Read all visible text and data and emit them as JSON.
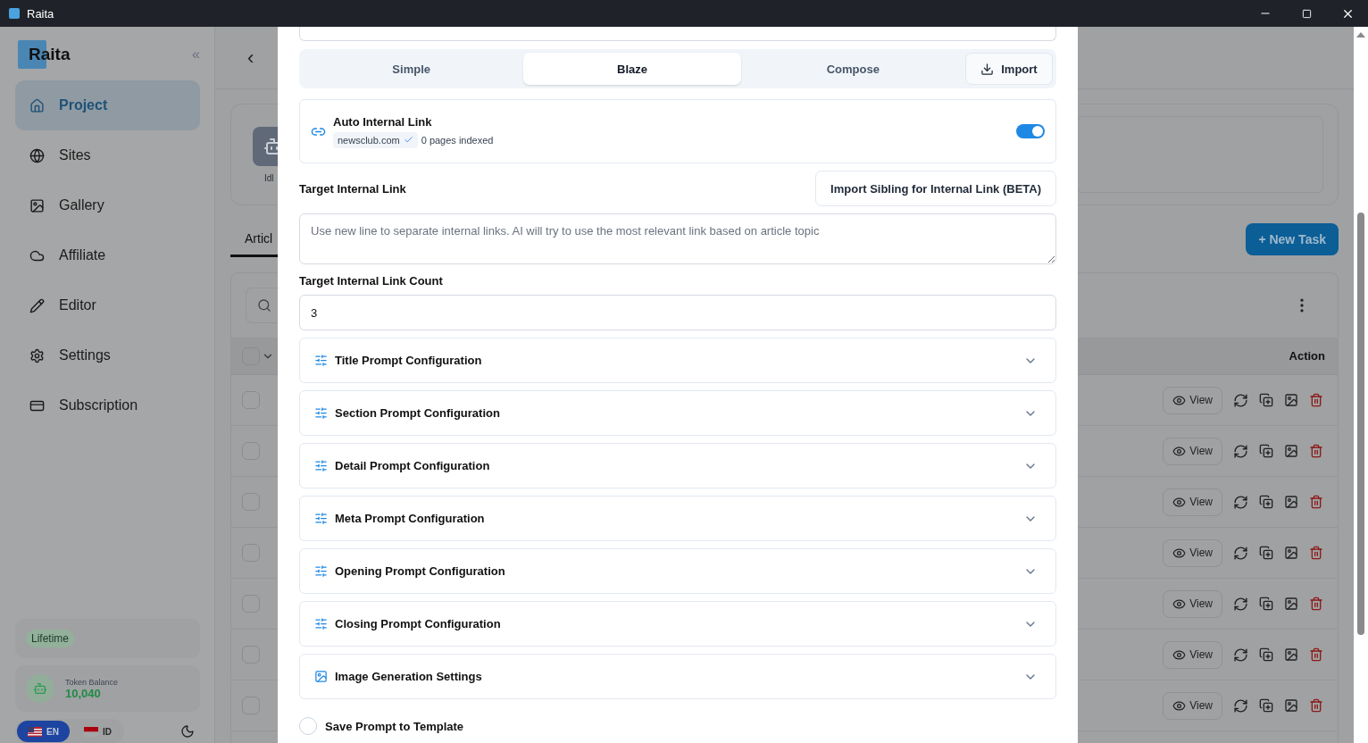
{
  "window": {
    "title": "Raita"
  },
  "sidebar": {
    "logo": "Raita",
    "collapse": "«",
    "items": [
      {
        "label": "Project",
        "selected": true
      },
      {
        "label": "Sites",
        "selected": false
      },
      {
        "label": "Gallery",
        "selected": false
      },
      {
        "label": "Affiliate",
        "selected": false
      },
      {
        "label": "Editor",
        "selected": false
      },
      {
        "label": "Settings",
        "selected": false
      },
      {
        "label": "Subscription",
        "selected": false
      }
    ],
    "plan": "Lifetime",
    "token_label": "Token Balance",
    "token_value": "10,040",
    "languages": [
      {
        "code": "EN",
        "selected": true
      },
      {
        "code": "ID",
        "selected": false
      }
    ]
  },
  "main": {
    "back": "‹",
    "status": "Idl",
    "tab": "Articl",
    "new_task": "+ New Task",
    "action_header": "Action",
    "select_all_checked": false,
    "rows": [
      {
        "view": "View",
        "checked": false
      },
      {
        "view": "View",
        "checked": false
      },
      {
        "view": "View",
        "checked": false
      },
      {
        "view": "View",
        "checked": false
      },
      {
        "view": "View",
        "checked": false
      },
      {
        "view": "View",
        "checked": false
      },
      {
        "view": "View",
        "checked": false
      }
    ]
  },
  "modal": {
    "modes": [
      {
        "label": "Simple",
        "selected": false
      },
      {
        "label": "Blaze",
        "selected": true
      },
      {
        "label": "Compose",
        "selected": false
      }
    ],
    "import": "Import",
    "auto_link": {
      "title": "Auto Internal Link",
      "domain": "newsclub.com",
      "indexed": "0 pages indexed",
      "on": true
    },
    "target_label": "Target Internal Link",
    "import_sibling": "Import Sibling for Internal Link (BETA)",
    "target_placeholder": "Use new line to separate internal links. AI will try to use the most relevant link based on article topic",
    "count_label": "Target Internal Link Count",
    "count_value": "3",
    "sections": [
      {
        "title": "Title Prompt Configuration",
        "kind": "prompt",
        "expanded": false
      },
      {
        "title": "Section Prompt Configuration",
        "kind": "prompt",
        "expanded": false
      },
      {
        "title": "Detail Prompt Configuration",
        "kind": "prompt",
        "expanded": false
      },
      {
        "title": "Meta Prompt Configuration",
        "kind": "prompt",
        "expanded": false
      },
      {
        "title": "Opening Prompt Configuration",
        "kind": "prompt",
        "expanded": false
      },
      {
        "title": "Closing Prompt Configuration",
        "kind": "prompt",
        "expanded": false
      },
      {
        "title": "Image Generation Settings",
        "kind": "image",
        "expanded": false
      }
    ],
    "save_template": {
      "label": "Save Prompt to Template",
      "checked": false
    }
  }
}
